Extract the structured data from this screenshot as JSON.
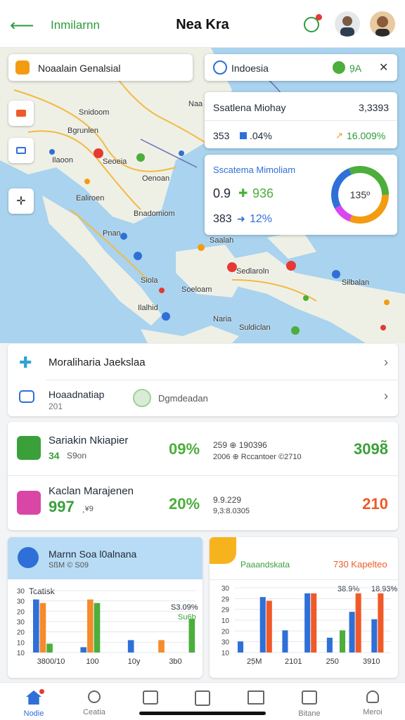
{
  "header": {
    "back_icon": "arrow-left-icon",
    "app_name": "Inmilarnn",
    "title": "Nea Kra"
  },
  "map": {
    "search_text": "Noaalain Genalsial",
    "region_text": "Indoesia",
    "region_value": "9̣A",
    "places": [
      "Snidoom",
      "Bgrunlen",
      "Seoeia",
      "Naa",
      "Ilaoon",
      "Oenoan",
      "Ealiroen",
      "Bnadomiom",
      "Pnan",
      "Saalah",
      "Siola",
      "Sedlaroln",
      "Soeloam",
      "Silbalan",
      "Suldiclan",
      "Naria",
      "Ilalhid"
    ]
  },
  "stat_card": {
    "title": "Ssatlena Miohay",
    "title_value": "3,3393",
    "left_value": "353",
    "left_pct": ".04%",
    "right_value": "16.009%"
  },
  "donut_card": {
    "title": "Sscatema Mimoliam",
    "row1_value": "0.9",
    "row1_delta": "936",
    "row2_value": "383",
    "row2_delta": "12%",
    "center": "135º",
    "colors": [
      "#f39c12",
      "#4cae3b",
      "#2f6fd8",
      "#d946ef",
      "#f59e0b"
    ]
  },
  "list_card": {
    "row1_label": "Moraliharia Jaekslaa",
    "row2_label": "Hoaadnatiap",
    "row2_sub": "201",
    "row2_tag": "Dgmdeadan"
  },
  "metrics": [
    {
      "name": "Sariakin Nkiapier",
      "value": "34",
      "sub": "S9on",
      "pct": "09%",
      "mid_top": "259  ⊕  190396",
      "mid_bottom": "2006  ⊕  Rccantoer  ©2710",
      "right": "3098̃",
      "color": "#3aa03a"
    },
    {
      "name": "Kaclan Marajenen",
      "value": "997",
      "sub": "¸¥9",
      "pct": "20%",
      "mid_top": "9.9.229",
      "mid_bottom": "9,3:8.0305",
      "right": "210",
      "color": "#d946a5"
    }
  ],
  "chart_data": [
    {
      "type": "bar",
      "title": "Marnn Soa l0alnana",
      "subtitle": "SßM © S09",
      "ylabel": "Tcatisk",
      "annotation_top": "S3.09%",
      "annotation_sub": "Su6b",
      "y_ticks": [
        "30",
        "30",
        "20",
        "30",
        "20",
        "10",
        "10"
      ],
      "x_labels": [
        "3800/10",
        "100",
        "10y",
        "3b0"
      ],
      "series": [
        {
          "name": "",
          "values": [
            30,
            0,
            3,
            0,
            7,
            0,
            0
          ],
          "color": "#2f6fd8"
        },
        {
          "name": "",
          "values": [
            28,
            0,
            30,
            0,
            0,
            7,
            0
          ],
          "color": "#f58b2a"
        },
        {
          "name": "",
          "values": [
            5,
            0,
            28,
            0,
            0,
            0,
            19
          ],
          "color": "#4cae3b"
        }
      ]
    },
    {
      "type": "bar",
      "title": "Paaandskata",
      "title_right": "730 Kapelteo",
      "y_ticks": [
        "30",
        "29",
        "29",
        "10",
        "20",
        "30",
        "10"
      ],
      "x_labels": [
        "25̣M",
        "2101",
        "250",
        "3910"
      ],
      "annotations": [
        "38.9%",
        "18.93%"
      ],
      "series": [
        {
          "name": "",
          "values": [
            6,
            30,
            12,
            32,
            8,
            22,
            18
          ],
          "color": "#2f6fd8"
        },
        {
          "name": "",
          "values": [
            0,
            28,
            0,
            32,
            0,
            32,
            32
          ],
          "color": "#f05a28"
        },
        {
          "name": "",
          "values": [
            0,
            0,
            0,
            0,
            12,
            0,
            0
          ],
          "color": "#4cae3b"
        }
      ]
    }
  ],
  "nav": [
    {
      "label": "Nodie",
      "icon": "home-icon",
      "active": true
    },
    {
      "label": "Ceatia",
      "icon": "search-icon",
      "active": false
    },
    {
      "label": "",
      "icon": "apps-icon",
      "active": false
    },
    {
      "label": "",
      "icon": "edit-square-icon",
      "active": false
    },
    {
      "label": "",
      "icon": "map-book-icon",
      "active": false
    },
    {
      "label": "Bitane",
      "icon": "folder-icon",
      "active": false
    },
    {
      "label": "Meroi",
      "icon": "person-icon",
      "active": false
    }
  ]
}
